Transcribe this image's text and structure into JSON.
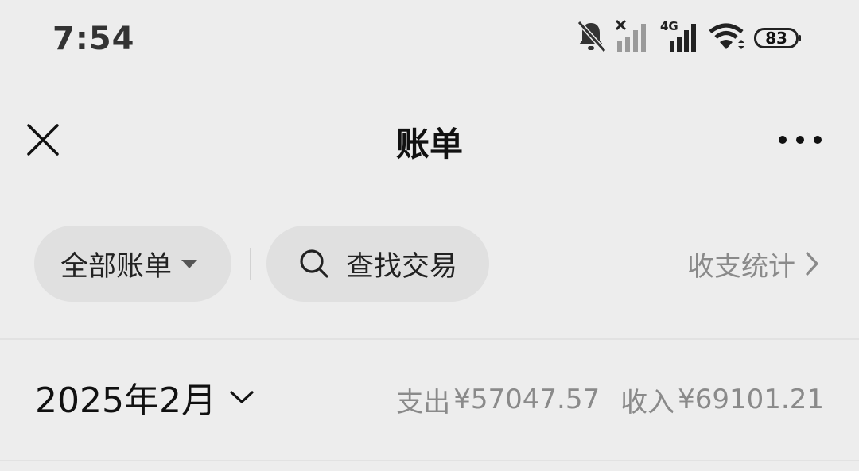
{
  "status_bar": {
    "time": "7:54",
    "network_label": "4G",
    "battery": "83",
    "icons": [
      "bell-off-icon",
      "no-signal-icon",
      "signal-4g-icon",
      "wifi-icon",
      "battery-icon"
    ]
  },
  "header": {
    "title": "账单",
    "close_icon": "close-icon",
    "more_icon": "more-horizontal-icon"
  },
  "filters": {
    "all_bills_label": "全部账单",
    "search_label": "查找交易",
    "stats_label": "收支统计"
  },
  "month_summary": {
    "month_label": "2025年2月",
    "expense_label": "支出",
    "expense_value": "¥57047.57",
    "income_label": "收入",
    "income_value": "¥69101.21"
  },
  "colors": {
    "background": "#ededed",
    "pill": "#e0e0e0",
    "secondary_text": "#8a8a8a",
    "primary_text": "#111111"
  }
}
